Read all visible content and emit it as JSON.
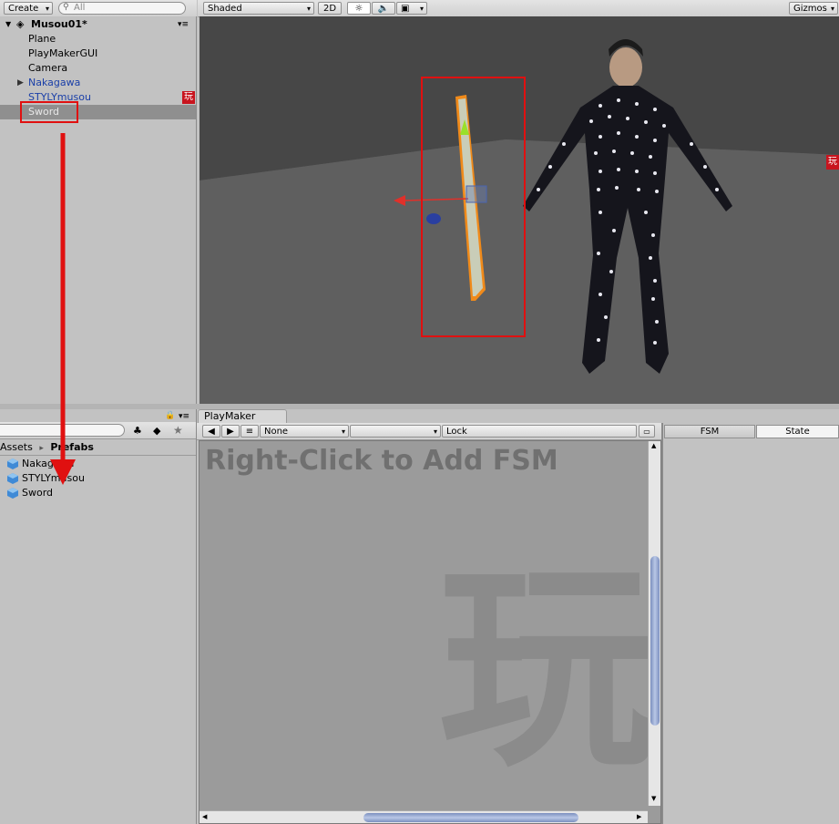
{
  "hierarchy": {
    "create_label": "Create",
    "search_placeholder": "All",
    "scene_name": "Musou01*",
    "items": [
      {
        "label": "Plane"
      },
      {
        "label": "PlayMakerGUI"
      },
      {
        "label": "Camera"
      },
      {
        "label": "Nakagawa"
      },
      {
        "label": "STYLYmusou"
      },
      {
        "label": "Sword"
      }
    ],
    "playmaker_badge": "玩"
  },
  "scene": {
    "shading_mode": "Shaded",
    "mode_2d": "2D",
    "gizmos_label": "Gizmos",
    "side_badge": "玩"
  },
  "project": {
    "breadcrumb_root": "Assets",
    "breadcrumb_sep": "▸",
    "breadcrumb_current": "Prefabs",
    "assets": [
      {
        "label": "Nakagawa"
      },
      {
        "label": "STYLYmusou"
      },
      {
        "label": "Sword"
      }
    ]
  },
  "playmaker": {
    "tab_label": "PlayMaker",
    "fsm_select": "None",
    "lock_label": "Lock",
    "fsm_tab": "FSM",
    "state_tab": "State",
    "hint": "Right-Click to Add FSM",
    "watermark": "玩"
  },
  "colors": {
    "annotation_red": "#e01010",
    "selection_orange": "#f08a1a",
    "prefab_blue": "#1a3fa8",
    "canvas_gray": "#9b9b9b",
    "selected_row": "#8f8f8f"
  }
}
